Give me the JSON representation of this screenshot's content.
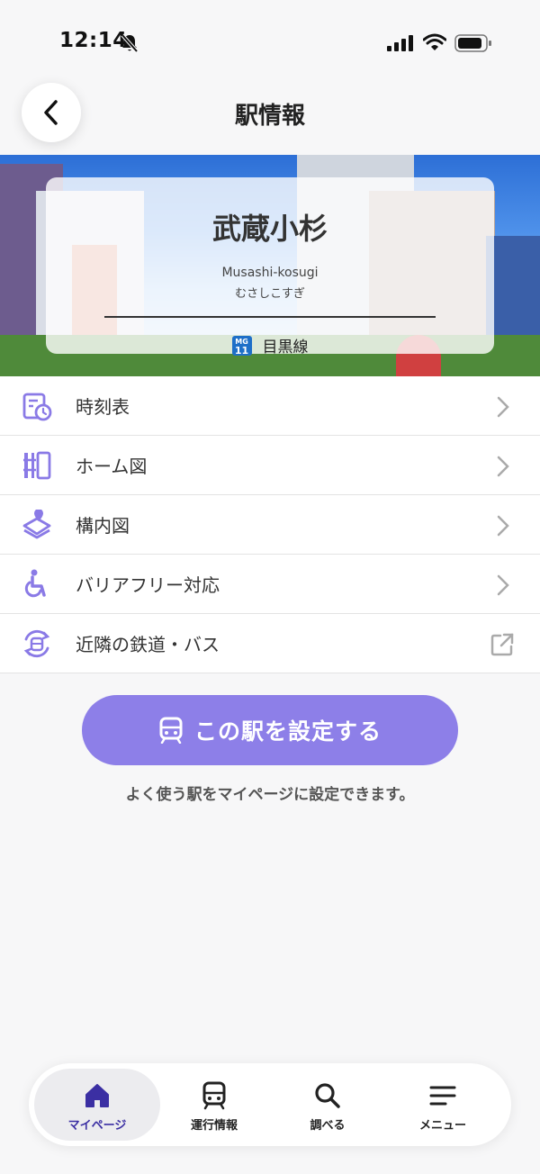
{
  "status_bar": {
    "time": "12:14"
  },
  "header": {
    "title": "駅情報"
  },
  "station": {
    "name": "武蔵小杉",
    "romaji": "Musashi-kosugi",
    "kana": "むさしこすぎ",
    "line_badge_top": "MG",
    "line_badge_number": "11",
    "line_name": "目黒線"
  },
  "menu": [
    {
      "label": "時刻表",
      "icon": "timetable-icon"
    },
    {
      "label": "ホーム図",
      "icon": "platform-map-icon"
    },
    {
      "label": "構内図",
      "icon": "station-map-icon"
    },
    {
      "label": "バリアフリー対応",
      "icon": "wheelchair-icon"
    },
    {
      "label": "近隣の鉄道・バス",
      "icon": "nearby-transit-icon"
    }
  ],
  "set_station": {
    "button_label": "この駅を設定する",
    "hint": "よく使う駅をマイページに設定できます。"
  },
  "tabs": [
    {
      "label": "マイページ",
      "icon": "home-icon",
      "active": true
    },
    {
      "label": "運行情報",
      "icon": "train-icon",
      "active": false
    },
    {
      "label": "調べる",
      "icon": "search-icon",
      "active": false
    },
    {
      "label": "メニュー",
      "icon": "menu-icon",
      "active": false
    }
  ],
  "colors": {
    "accent": "#8d7fe8",
    "active_tab": "#3b2fa3",
    "icon": "#8a7ae6",
    "line_badge": "#1e6fc8"
  }
}
